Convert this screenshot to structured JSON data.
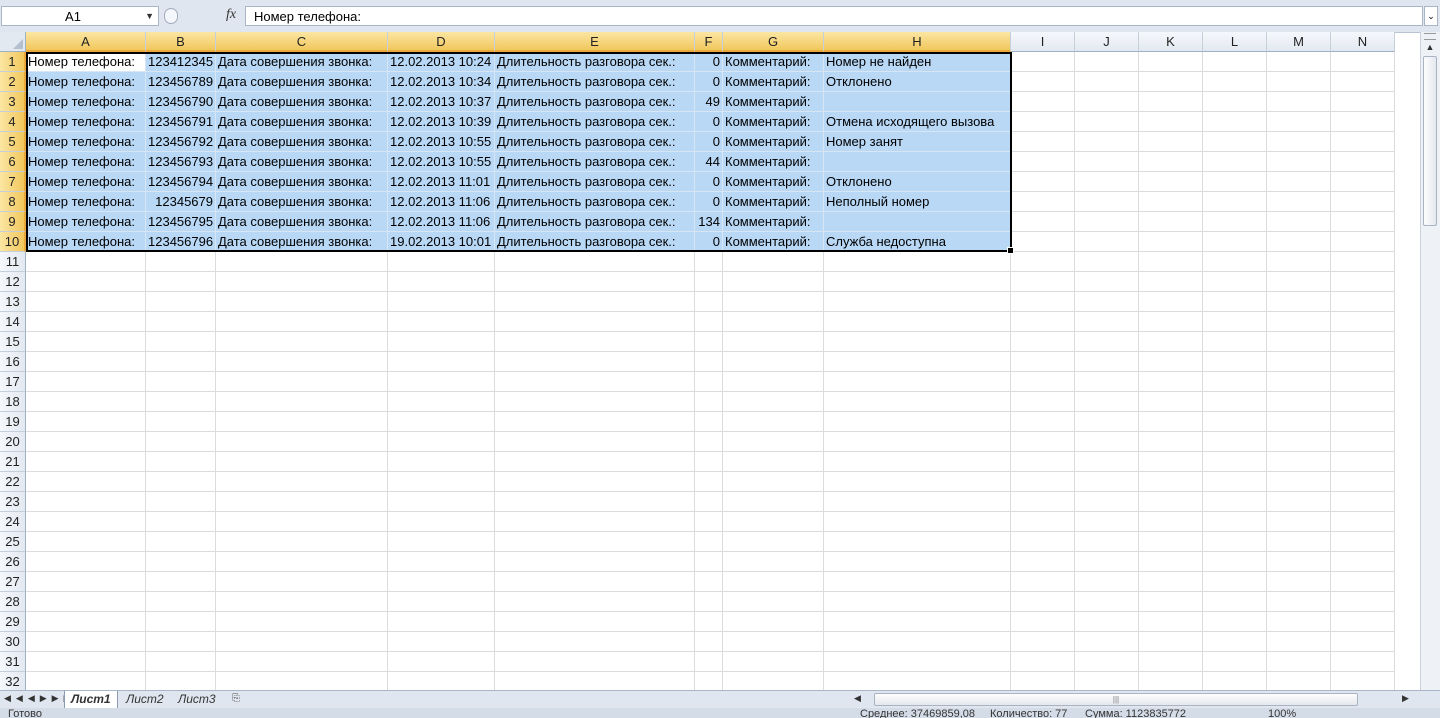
{
  "formula_bar": {
    "name_box": "A1",
    "fx_label": "fx",
    "content": "Номер телефона:"
  },
  "columns": [
    "A",
    "B",
    "C",
    "D",
    "E",
    "F",
    "G",
    "H",
    "I",
    "J",
    "K",
    "L",
    "M",
    "N"
  ],
  "row_numbers": [
    "1",
    "2",
    "3",
    "4",
    "5",
    "6",
    "7",
    "8",
    "9",
    "10",
    "11",
    "12",
    "13",
    "14",
    "15",
    "16",
    "17",
    "18",
    "19",
    "20",
    "21",
    "22",
    "23",
    "24",
    "25",
    "26",
    "27",
    "28",
    "29",
    "30",
    "31",
    "32"
  ],
  "rows": [
    [
      "Номер телефона:",
      "123412345",
      "Дата совершения звонка:",
      "12.02.2013 10:24",
      "Длительность разговора сек.:",
      "0",
      "Комментарий:",
      "Номер не найден"
    ],
    [
      "Номер телефона:",
      "123456789",
      "Дата совершения звонка:",
      "12.02.2013 10:34",
      "Длительность разговора сек.:",
      "0",
      "Комментарий:",
      "Отклонено"
    ],
    [
      "Номер телефона:",
      "123456790",
      "Дата совершения звонка:",
      "12.02.2013 10:37",
      "Длительность разговора сек.:",
      "49",
      "Комментарий:",
      ""
    ],
    [
      "Номер телефона:",
      "123456791",
      "Дата совершения звонка:",
      "12.02.2013 10:39",
      "Длительность разговора сек.:",
      "0",
      "Комментарий:",
      "Отмена исходящего вызова"
    ],
    [
      "Номер телефона:",
      "123456792",
      "Дата совершения звонка:",
      "12.02.2013 10:55",
      "Длительность разговора сек.:",
      "0",
      "Комментарий:",
      "Номер занят"
    ],
    [
      "Номер телефона:",
      "123456793",
      "Дата совершения звонка:",
      "12.02.2013 10:55",
      "Длительность разговора сек.:",
      "44",
      "Комментарий:",
      ""
    ],
    [
      "Номер телефона:",
      "123456794",
      "Дата совершения звонка:",
      "12.02.2013 11:01",
      "Длительность разговора сек.:",
      "0",
      "Комментарий:",
      "Отклонено"
    ],
    [
      "Номер телефона:",
      "12345679",
      "Дата совершения звонка:",
      "12.02.2013 11:06",
      "Длительность разговора сек.:",
      "0",
      "Комментарий:",
      "Неполный номер"
    ],
    [
      "Номер телефона:",
      "123456795",
      "Дата совершения звонка:",
      "12.02.2013 11:06",
      "Длительность разговора сек.:",
      "134",
      "Комментарий:",
      ""
    ],
    [
      "Номер телефона:",
      "123456796",
      "Дата совершения звонка:",
      "19.02.2013 10:01",
      "Длительность разговора сек.:",
      "0",
      "Комментарий:",
      "Служба недоступна"
    ]
  ],
  "sheet_tabs": [
    "Лист1",
    "Лист2",
    "Лист3"
  ],
  "active_sheet": "Лист1",
  "status_bar": {
    "ready": "Готово",
    "average": "Среднее: 37469859,08",
    "count": "Количество: 77",
    "sum": "Сумма: 1123835772",
    "zoom": "100%"
  },
  "colors": {
    "selection": "#b8d8f6",
    "header_selected": "#f1c75c",
    "gridline": "#dadcdd"
  }
}
